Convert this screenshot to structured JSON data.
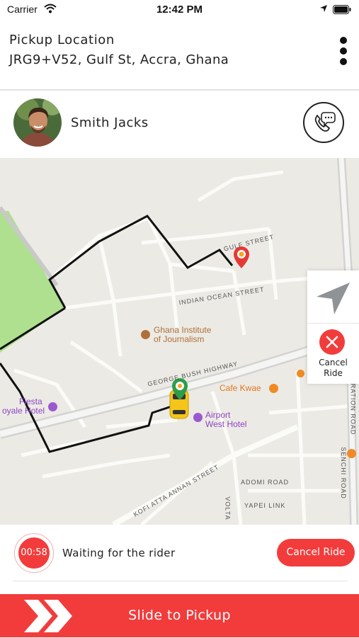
{
  "status_bar": {
    "carrier": "Carrier",
    "time": "12:42 PM"
  },
  "header": {
    "title": "Pickup Location",
    "address": "JRG9+V52, Gulf St, Accra, Ghana",
    "menu_icon": "more-vertical-icon"
  },
  "rider": {
    "name": "Smith Jacks",
    "call_icon": "phone-chat-icon"
  },
  "map": {
    "streets": [
      "GULF STREET",
      "INDIAN OCEAN STREET",
      "GEORGE BUSH HIGHWAY",
      "KOFI ATTA ANNAN STREET",
      "ADOMI ROAD",
      "YAPEI LINK",
      "SENCHI ROAD",
      "RATION ROAD",
      "VOLTA"
    ],
    "pois": {
      "ghana_institute_line1": "Ghana Institute",
      "ghana_institute_line2": "of Journalism",
      "cafe": "Cafe Kwae",
      "airport_line1": "Airport",
      "airport_line2": "West Hotel",
      "fiesta_line1": "Fiesta",
      "fiesta_line2": "oyale Hotel"
    },
    "colors": {
      "route": "#111111",
      "park": "#aee08f",
      "poi_purple": "#9b59d0",
      "poi_orange": "#f08a24",
      "poi_brown": "#b0703a"
    }
  },
  "side_panel": {
    "recenter_icon": "navigation-arrow-icon",
    "cancel_icon": "close-icon",
    "cancel_label_line1": "Cancel",
    "cancel_label_line2": "Ride"
  },
  "waiting": {
    "timer": "00:58",
    "text": "Waiting for the rider",
    "cancel_button": "Cancel Ride"
  },
  "slide": {
    "label": "Slide to Pickup",
    "handle_icon": "double-chevron-right-icon"
  },
  "accent_color": "#f23c3c"
}
